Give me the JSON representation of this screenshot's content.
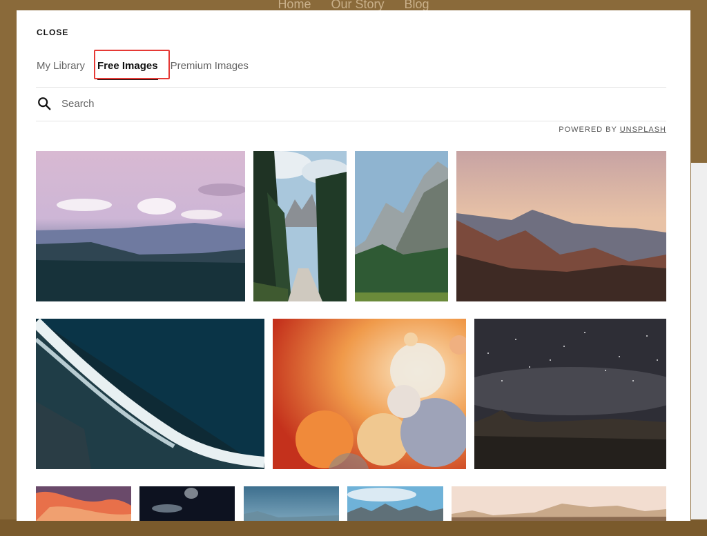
{
  "background_nav": {
    "items": [
      "Home",
      "Our Story",
      "Blog"
    ]
  },
  "modal": {
    "close_label": "CLOSE",
    "tabs": [
      {
        "label": "My Library",
        "active": false
      },
      {
        "label": "Free Images",
        "active": true
      },
      {
        "label": "Premium Images",
        "active": false
      }
    ],
    "search": {
      "placeholder": "Search",
      "value": ""
    },
    "powered_by": {
      "text": "POWERED BY",
      "link": "UNSPLASH"
    },
    "images": [
      "pink-sky-forest-mountains",
      "forest-path-rock-peaks",
      "rocky-mountain-forest",
      "sunset-mountain-range",
      "aerial-ocean-wave",
      "orange-bubbles-abstract",
      "starry-night-mountains",
      "pink-clouds-sky",
      "jellyfish-dark-water",
      "blue-misty-landscape",
      "blue-sky-rocky-ridge",
      "cream-sky-mountains"
    ]
  },
  "colors": {
    "accent_highlight": "#e53935",
    "page_background": "#8a6a3a",
    "modal_background": "#ffffff"
  }
}
